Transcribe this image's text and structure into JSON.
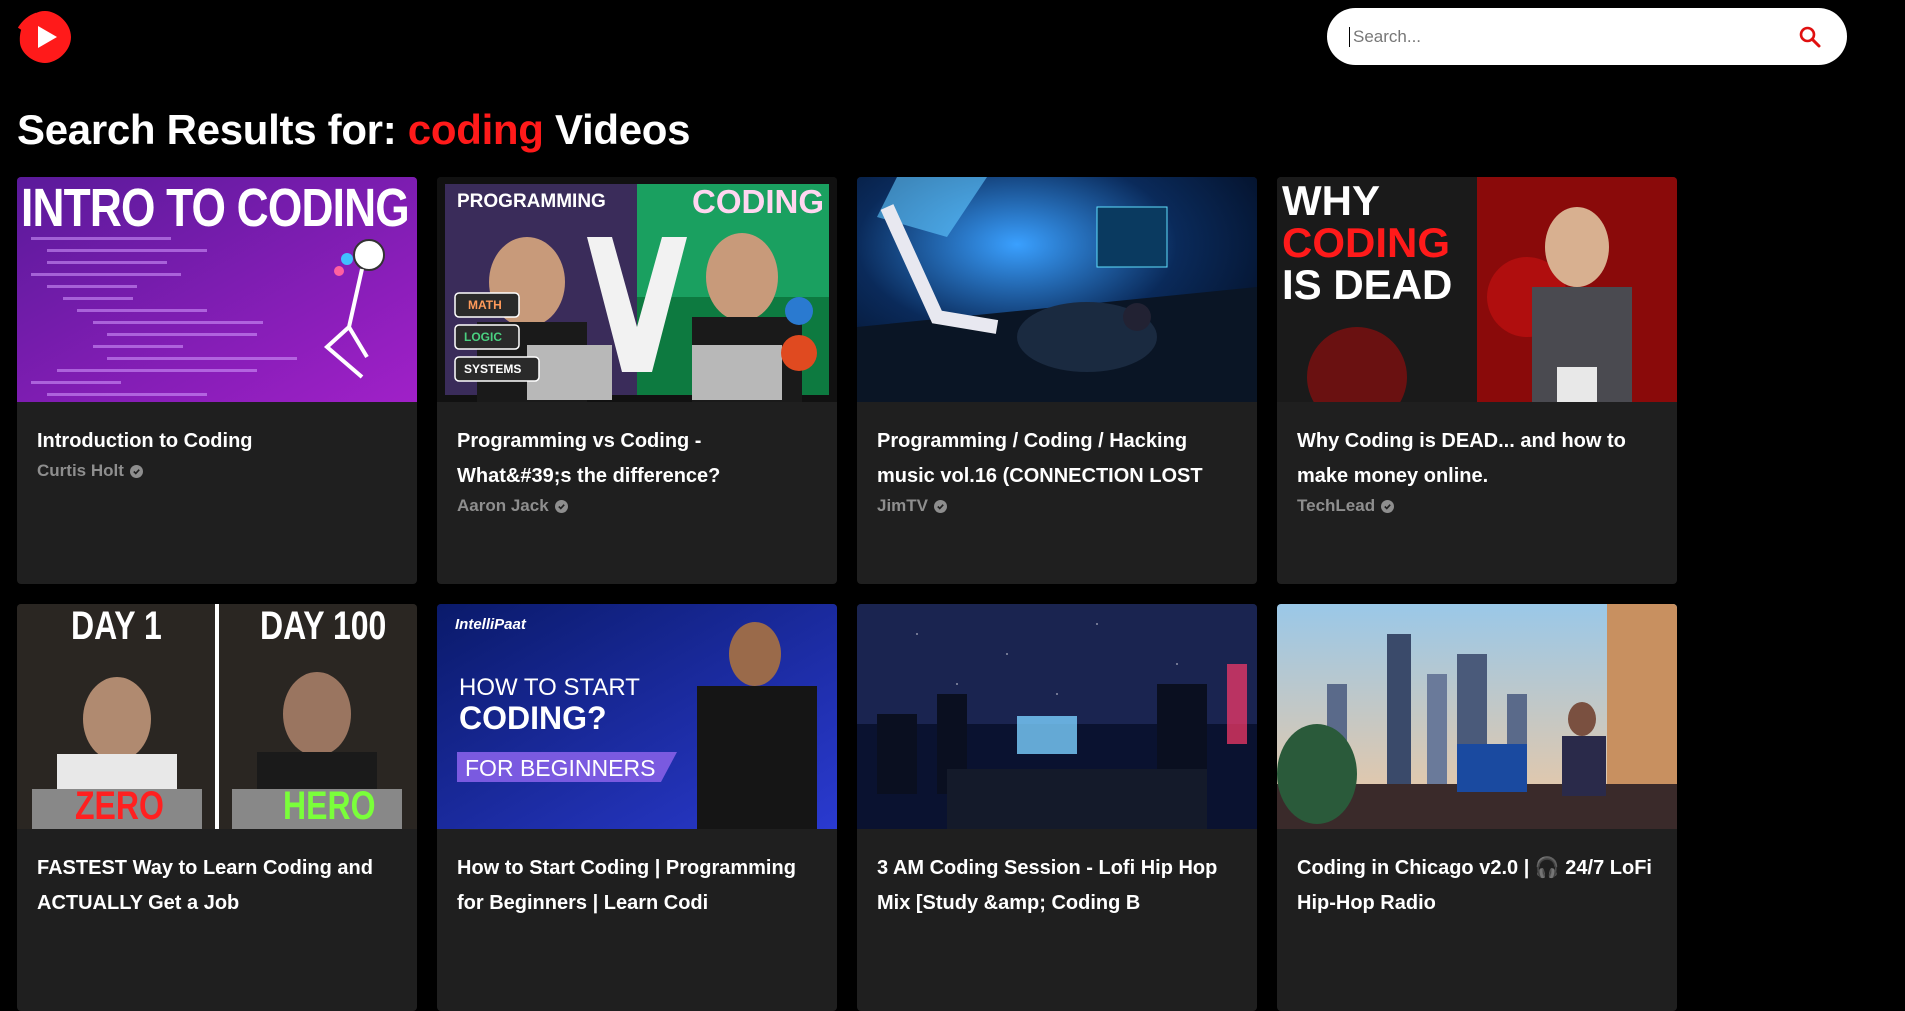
{
  "header": {
    "logo_icon": "play-logo-icon",
    "search_placeholder": "Search...",
    "search_icon": "search-icon",
    "accent": "#ff1a1a"
  },
  "heading": {
    "prefix": "Search Results for: ",
    "query": "coding",
    "suffix": " Videos"
  },
  "videos": [
    {
      "title": "Introduction to Coding",
      "channel": "Curtis Holt",
      "thumb_text": [
        "INTRO TO CODING"
      ]
    },
    {
      "title": "Programming vs Coding - What&#39;s the difference?",
      "channel": "Aaron Jack",
      "thumb_text": [
        "PROGRAMMING",
        "CODING",
        "VS",
        "MATH",
        "LOGIC",
        "SYSTEMS"
      ]
    },
    {
      "title": "Programming / Coding / Hacking music vol.16 (CONNECTION LOST",
      "channel": "JimTV",
      "thumb_text": []
    },
    {
      "title": "Why Coding is DEAD... and how to make money online.",
      "channel": "TechLead",
      "thumb_text": [
        "WHY",
        "CODING",
        "IS DEAD"
      ]
    },
    {
      "title": "FASTEST Way to Learn Coding and ACTUALLY Get a Job",
      "channel": "",
      "thumb_text": [
        "DAY 1",
        "DAY 100",
        "ZERO",
        "HERO"
      ]
    },
    {
      "title": "How to Start Coding | Programming for Beginners | Learn Codi",
      "channel": "",
      "thumb_text": [
        "IntelliPaat",
        "HOW TO START",
        "CODING?",
        "FOR BEGINNERS"
      ]
    },
    {
      "title": "3 AM Coding Session - Lofi Hip Hop Mix [Study &amp; Coding B",
      "channel": "",
      "thumb_text": []
    },
    {
      "title": "Coding in Chicago v2.0 | 🎧 24/7 LoFi Hip-Hop Radio",
      "channel": "",
      "thumb_text": []
    }
  ]
}
